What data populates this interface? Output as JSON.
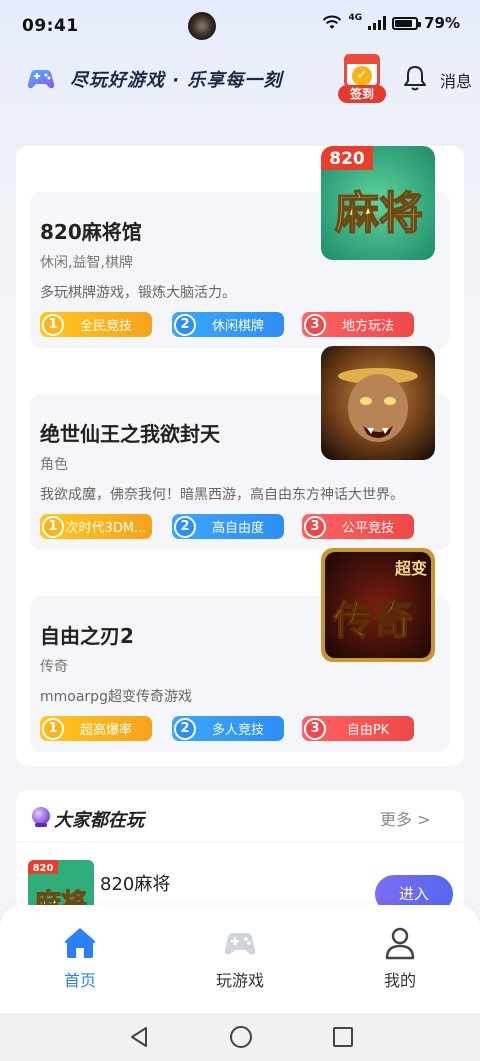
{
  "status_bar": {
    "time": "09:41",
    "network_label": "4G",
    "battery": "79%",
    "battery_level": 0.79
  },
  "header": {
    "slogan": "尽玩好游戏 · 乐享每一刻",
    "signin_label": "签到",
    "message_label": "消息"
  },
  "games": [
    {
      "title": "820麻将馆",
      "category": "休闲,益智,棋牌",
      "description": "多玩棋牌游戏，锻炼大脑活力。",
      "icon_label_top": "820",
      "icon_label_main": "麻将",
      "tags": [
        {
          "num": "1",
          "label": "全民竞技"
        },
        {
          "num": "2",
          "label": "休闲棋牌"
        },
        {
          "num": "3",
          "label": "地方玩法"
        }
      ]
    },
    {
      "title": "绝世仙王之我欲封天",
      "category": "角色",
      "description": "我欲成魔，佛奈我何！暗黑西游，高自由东方神话大世界。",
      "tags": [
        {
          "num": "1",
          "label": "次时代3DM..."
        },
        {
          "num": "2",
          "label": "高自由度"
        },
        {
          "num": "3",
          "label": "公平竞技"
        }
      ]
    },
    {
      "title": "自由之刃2",
      "category": "传奇",
      "description": "mmoarpg超变传奇游戏",
      "icon_label_top": "超变",
      "icon_label_main": "传奇",
      "tags": [
        {
          "num": "1",
          "label": "超高爆率"
        },
        {
          "num": "2",
          "label": "多人竞技"
        },
        {
          "num": "3",
          "label": "自由PK"
        }
      ]
    }
  ],
  "playing": {
    "title": "大家都在玩",
    "more_label": "更多 >",
    "item_name": "820麻将",
    "thumb_label_top": "820",
    "thumb_label_main": "麻将",
    "enter_label": "进入"
  },
  "tabs": [
    {
      "label": "首页",
      "active": true
    },
    {
      "label": "玩游戏",
      "active": false
    },
    {
      "label": "我的",
      "active": false
    }
  ],
  "colors": {
    "accent": "#2d7ff9",
    "tag1": "#f9b61b",
    "tag2": "#2d8ef3",
    "tag3": "#f04848",
    "enter_button": "#6a6bf1"
  }
}
